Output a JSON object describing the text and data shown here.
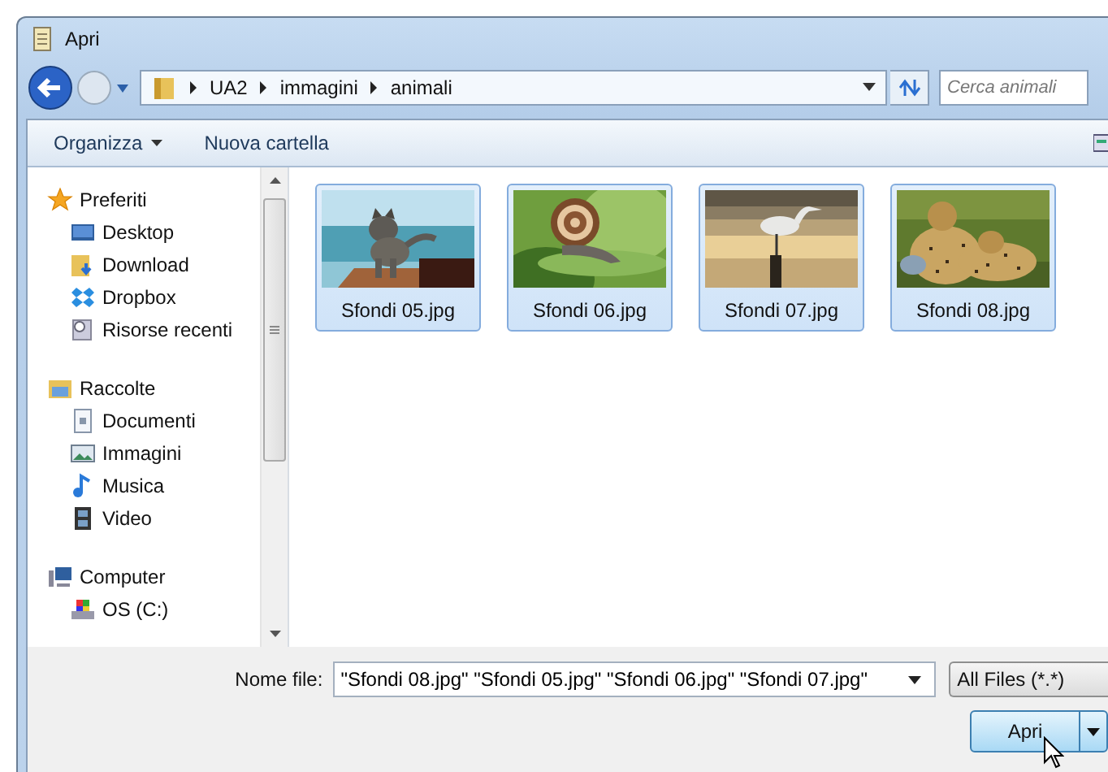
{
  "window": {
    "title": "Apri"
  },
  "address": {
    "path": [
      "UA2",
      "immagini",
      "animali"
    ]
  },
  "search": {
    "placeholder": "Cerca animali"
  },
  "toolbar": {
    "items": [
      {
        "label": "Organizza",
        "kind": "menu"
      },
      {
        "label": "Nuova cartella",
        "kind": "button"
      }
    ]
  },
  "sidebar": {
    "groups": [
      {
        "label": "Preferiti",
        "kind": "star",
        "children": [
          {
            "label": "Desktop",
            "kind": "desktop"
          },
          {
            "label": "Download",
            "kind": "download"
          },
          {
            "label": "Dropbox",
            "kind": "dropbox"
          },
          {
            "label": "Risorse recenti",
            "kind": "recent"
          }
        ]
      },
      {
        "label": "Raccolte",
        "kind": "library",
        "children": [
          {
            "label": "Documenti",
            "kind": "document"
          },
          {
            "label": "Immagini",
            "kind": "images"
          },
          {
            "label": "Musica",
            "kind": "music"
          },
          {
            "label": "Video",
            "kind": "video"
          }
        ]
      },
      {
        "label": "Computer",
        "kind": "computer",
        "children": [
          {
            "label": "OS (C:)",
            "kind": "drive"
          }
        ]
      }
    ]
  },
  "files": [
    {
      "name": "Sfondi 05.jpg",
      "selected": true,
      "kind": "picture"
    },
    {
      "name": "Sfondi 06.jpg",
      "selected": true,
      "kind": "picture"
    },
    {
      "name": "Sfondi 07.jpg",
      "selected": true,
      "kind": "picture"
    },
    {
      "name": "Sfondi 08.jpg",
      "selected": true,
      "kind": "picture"
    }
  ],
  "footer": {
    "file_name_label": "Nome file:",
    "file_name": "\"Sfondi 08.jpg\" \"Sfondi 05.jpg\" \"Sfondi 06.jpg\" \"Sfondi 07.jpg\"",
    "file_type": "All Files (*.*)",
    "open_button": "Apri"
  }
}
